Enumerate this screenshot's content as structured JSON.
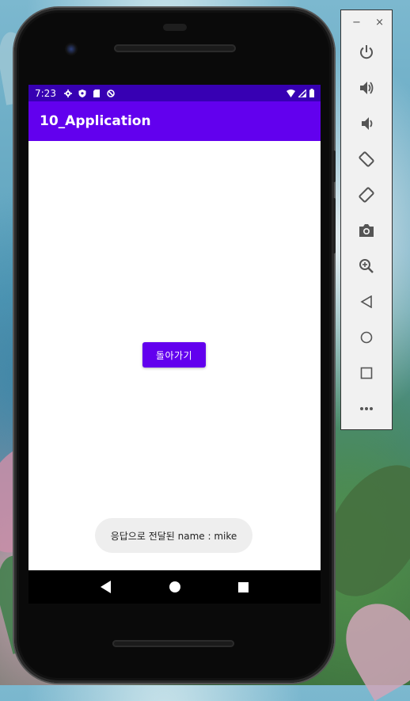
{
  "status_bar": {
    "time": "7:23",
    "icons_left": [
      "settings-icon",
      "shield-icon",
      "sd-card-icon",
      "no-signal-circle-icon"
    ],
    "icons_right": [
      "wifi-icon",
      "cell-signal-icon",
      "battery-icon"
    ]
  },
  "app_bar": {
    "title": "10_Application"
  },
  "content": {
    "back_button_label": "돌아가기"
  },
  "toast": {
    "message": "응답으로 전달된 name : mike"
  },
  "nav_bar": {
    "buttons": [
      "back",
      "home",
      "recents"
    ]
  },
  "emulator_toolbar": {
    "minimize": "−",
    "close": "×",
    "items": [
      "power",
      "volume-up",
      "volume-down",
      "rotate-left",
      "rotate-right",
      "screenshot",
      "zoom",
      "back",
      "home",
      "overview",
      "more"
    ]
  },
  "colors": {
    "status_bar": "#3700b3",
    "primary": "#6200ee",
    "toast_bg": "#eeeeee"
  }
}
